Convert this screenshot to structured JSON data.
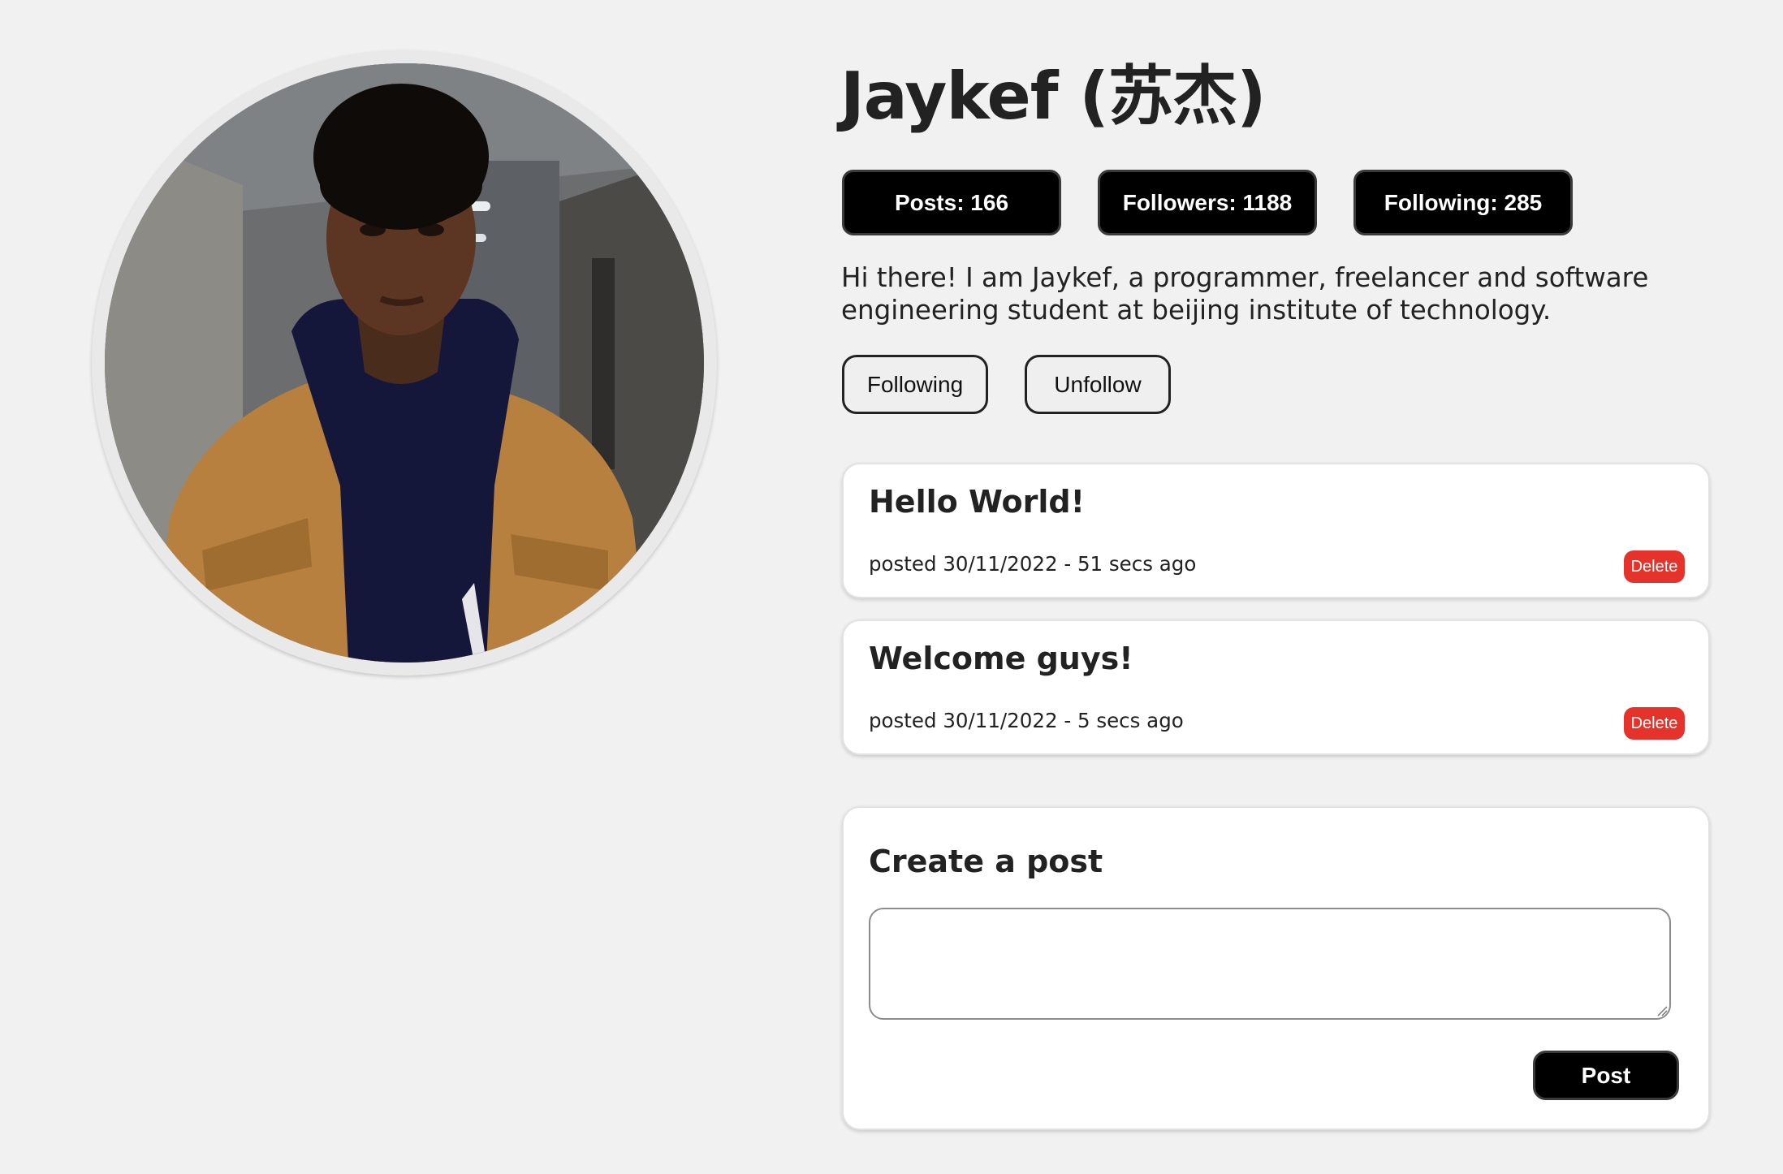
{
  "profile": {
    "name": "Jaykef (苏杰)",
    "bio": "Hi there! I am Jaykef, a programmer, freelancer and software engineering student at beijing institute of technology.",
    "stats": {
      "posts": "Posts: 166",
      "followers": "Followers: 1188",
      "following": "Following: 285"
    },
    "actions": {
      "following_label": "Following",
      "unfollow_label": "Unfollow"
    }
  },
  "posts": [
    {
      "title": "Hello World!",
      "meta": "posted 30/11/2022 - 51 secs ago",
      "delete_label": "Delete"
    },
    {
      "title": "Welcome guys!",
      "meta": "posted 30/11/2022 - 5 secs ago",
      "delete_label": "Delete"
    }
  ],
  "create_post": {
    "title": "Create a post",
    "textarea_value": "",
    "submit_label": "Post"
  },
  "colors": {
    "background": "#f1f1f1",
    "pill": "#000000",
    "delete": "#e5322a",
    "card": "#ffffff"
  },
  "icons": {
    "resize": "resize-handle-icon"
  }
}
